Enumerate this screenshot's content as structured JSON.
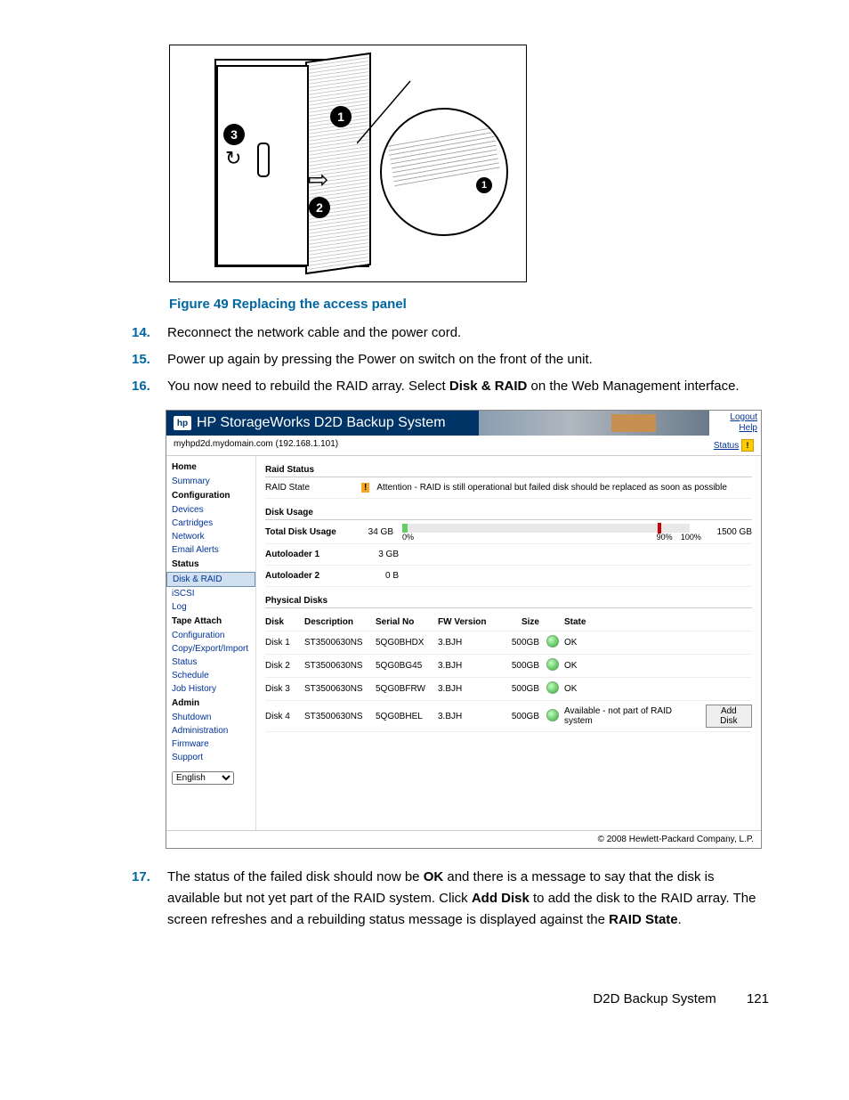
{
  "figure": {
    "caption": "Figure 49 Replacing the access panel",
    "callouts": [
      "1",
      "2",
      "3",
      "1"
    ]
  },
  "steps": [
    {
      "num": "14.",
      "text": "Reconnect the network cable and the power cord."
    },
    {
      "num": "15.",
      "text": "Power up again by pressing the Power on switch on the front of the unit."
    },
    {
      "num": "16.",
      "pre": "You now need to rebuild the RAID array. Select ",
      "bold": "Disk & RAID",
      "post": " on the Web Management interface."
    }
  ],
  "app": {
    "title": "HP StorageWorks D2D Backup System",
    "logo": "hp",
    "links": {
      "logout": "Logout",
      "help": "Help"
    },
    "host": "myhpd2d.mydomain.com (192.168.1.101)",
    "status_label": "Status",
    "sidebar": {
      "groups": [
        {
          "head": "Home",
          "items": [
            "Summary"
          ]
        },
        {
          "head": "Configuration",
          "items": [
            "Devices",
            "Cartridges",
            "Network",
            "Email Alerts"
          ]
        },
        {
          "head": "Status",
          "items": [
            "Disk & RAID",
            "iSCSI",
            "Log"
          ]
        },
        {
          "head": "Tape Attach",
          "items": [
            "Configuration",
            "Copy/Export/Import",
            "Status",
            "Schedule",
            "Job History"
          ]
        },
        {
          "head": "Admin",
          "items": [
            "Shutdown",
            "Administration",
            "Firmware",
            "Support"
          ]
        }
      ],
      "active": "Disk & RAID",
      "language": "English"
    },
    "raid": {
      "section": "Raid Status",
      "state_label": "RAID State",
      "state_icon": "!",
      "state_msg": "Attention - RAID is still operational but failed disk should be replaced as soon as possible"
    },
    "usage": {
      "section": "Disk Usage",
      "total_label": "Total Disk Usage",
      "total_val": "34 GB",
      "percent": "0%",
      "mark90": "90%",
      "mark100": "100%",
      "capacity": "1500 GB",
      "autoloaders": [
        {
          "label": "Autoloader 1",
          "val": "3 GB"
        },
        {
          "label": "Autoloader 2",
          "val": "0 B"
        }
      ]
    },
    "disks": {
      "section": "Physical Disks",
      "headers": {
        "disk": "Disk",
        "desc": "Description",
        "serial": "Serial No",
        "fw": "FW Version",
        "size": "Size",
        "state": "State"
      },
      "rows": [
        {
          "disk": "Disk 1",
          "desc": "ST3500630NS",
          "serial": "5QG0BHDX",
          "fw": "3.BJH",
          "size": "500GB",
          "state": "OK"
        },
        {
          "disk": "Disk 2",
          "desc": "ST3500630NS",
          "serial": "5QG0BG45",
          "fw": "3.BJH",
          "size": "500GB",
          "state": "OK"
        },
        {
          "disk": "Disk 3",
          "desc": "ST3500630NS",
          "serial": "5QG0BFRW",
          "fw": "3.BJH",
          "size": "500GB",
          "state": "OK"
        },
        {
          "disk": "Disk 4",
          "desc": "ST3500630NS",
          "serial": "5QG0BHEL",
          "fw": "3.BJH",
          "size": "500GB",
          "state": "Available - not part of RAID system",
          "button": "Add Disk"
        }
      ]
    },
    "footer": "© 2008 Hewlett-Packard Company, L.P."
  },
  "step17": {
    "num": "17.",
    "p1": "The status of the failed disk should now be ",
    "b1": "OK",
    "p2": " and there is a message to say that the disk is available but not yet part of the RAID system. Click ",
    "b2": "Add Disk",
    "p3": " to add the disk to the RAID array. The screen refreshes and a rebuilding status message is displayed against the ",
    "b3": "RAID State",
    "p4": "."
  },
  "footer": {
    "title": "D2D Backup System",
    "page": "121"
  }
}
